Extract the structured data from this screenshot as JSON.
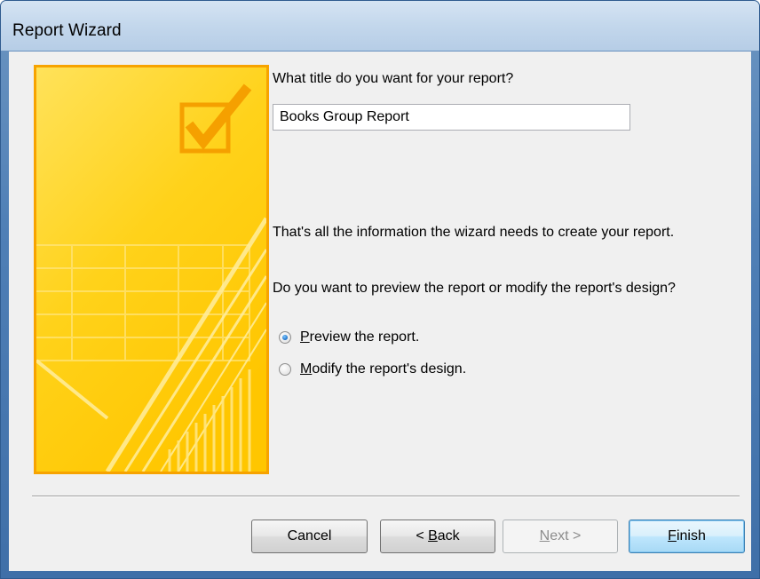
{
  "window": {
    "title": "Report Wizard"
  },
  "content": {
    "title_prompt": "What title do you want for your report?",
    "title_value": "Books Group Report",
    "info": "That's all the information the wizard needs to create your report.",
    "question": "Do you want to preview the report or modify the report's design?",
    "options": [
      {
        "accel": "P",
        "rest": "review the report.",
        "checked": true
      },
      {
        "accel": "M",
        "rest": "odify the report's design.",
        "checked": false
      }
    ]
  },
  "buttons": {
    "cancel": {
      "label": "Cancel"
    },
    "back": {
      "prefix": "< ",
      "accel": "B",
      "rest": "ack"
    },
    "next": {
      "accel": "N",
      "rest": "ext >",
      "enabled": false
    },
    "finish": {
      "accel": "F",
      "rest": "inish"
    }
  },
  "colors": {
    "image_border": "#f7a300",
    "image_yellow": "#ffd21a",
    "finish_highlight": "#3c7fb1"
  },
  "icons": {
    "side_image": "checkbox-report-illustration"
  }
}
